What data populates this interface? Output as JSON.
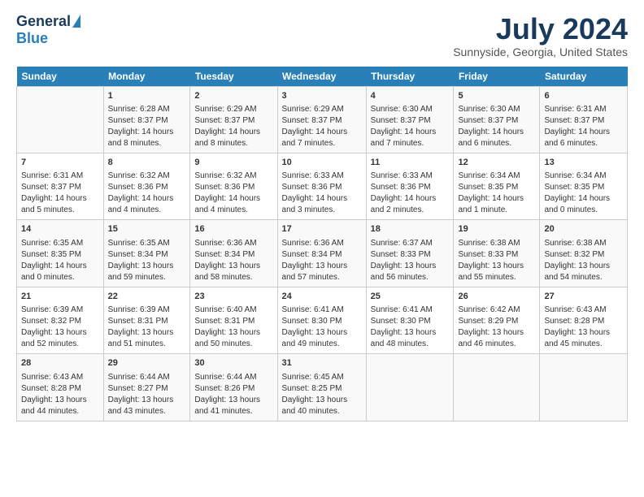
{
  "logo": {
    "general": "General",
    "blue": "Blue"
  },
  "title": "July 2024",
  "location": "Sunnyside, Georgia, United States",
  "days_header": [
    "Sunday",
    "Monday",
    "Tuesday",
    "Wednesday",
    "Thursday",
    "Friday",
    "Saturday"
  ],
  "weeks": [
    [
      {
        "day": "",
        "content": ""
      },
      {
        "day": "1",
        "content": "Sunrise: 6:28 AM\nSunset: 8:37 PM\nDaylight: 14 hours\nand 8 minutes."
      },
      {
        "day": "2",
        "content": "Sunrise: 6:29 AM\nSunset: 8:37 PM\nDaylight: 14 hours\nand 8 minutes."
      },
      {
        "day": "3",
        "content": "Sunrise: 6:29 AM\nSunset: 8:37 PM\nDaylight: 14 hours\nand 7 minutes."
      },
      {
        "day": "4",
        "content": "Sunrise: 6:30 AM\nSunset: 8:37 PM\nDaylight: 14 hours\nand 7 minutes."
      },
      {
        "day": "5",
        "content": "Sunrise: 6:30 AM\nSunset: 8:37 PM\nDaylight: 14 hours\nand 6 minutes."
      },
      {
        "day": "6",
        "content": "Sunrise: 6:31 AM\nSunset: 8:37 PM\nDaylight: 14 hours\nand 6 minutes."
      }
    ],
    [
      {
        "day": "7",
        "content": "Sunrise: 6:31 AM\nSunset: 8:37 PM\nDaylight: 14 hours\nand 5 minutes."
      },
      {
        "day": "8",
        "content": "Sunrise: 6:32 AM\nSunset: 8:36 PM\nDaylight: 14 hours\nand 4 minutes."
      },
      {
        "day": "9",
        "content": "Sunrise: 6:32 AM\nSunset: 8:36 PM\nDaylight: 14 hours\nand 4 minutes."
      },
      {
        "day": "10",
        "content": "Sunrise: 6:33 AM\nSunset: 8:36 PM\nDaylight: 14 hours\nand 3 minutes."
      },
      {
        "day": "11",
        "content": "Sunrise: 6:33 AM\nSunset: 8:36 PM\nDaylight: 14 hours\nand 2 minutes."
      },
      {
        "day": "12",
        "content": "Sunrise: 6:34 AM\nSunset: 8:35 PM\nDaylight: 14 hours\nand 1 minute."
      },
      {
        "day": "13",
        "content": "Sunrise: 6:34 AM\nSunset: 8:35 PM\nDaylight: 14 hours\nand 0 minutes."
      }
    ],
    [
      {
        "day": "14",
        "content": "Sunrise: 6:35 AM\nSunset: 8:35 PM\nDaylight: 14 hours\nand 0 minutes."
      },
      {
        "day": "15",
        "content": "Sunrise: 6:35 AM\nSunset: 8:34 PM\nDaylight: 13 hours\nand 59 minutes."
      },
      {
        "day": "16",
        "content": "Sunrise: 6:36 AM\nSunset: 8:34 PM\nDaylight: 13 hours\nand 58 minutes."
      },
      {
        "day": "17",
        "content": "Sunrise: 6:36 AM\nSunset: 8:34 PM\nDaylight: 13 hours\nand 57 minutes."
      },
      {
        "day": "18",
        "content": "Sunrise: 6:37 AM\nSunset: 8:33 PM\nDaylight: 13 hours\nand 56 minutes."
      },
      {
        "day": "19",
        "content": "Sunrise: 6:38 AM\nSunset: 8:33 PM\nDaylight: 13 hours\nand 55 minutes."
      },
      {
        "day": "20",
        "content": "Sunrise: 6:38 AM\nSunset: 8:32 PM\nDaylight: 13 hours\nand 54 minutes."
      }
    ],
    [
      {
        "day": "21",
        "content": "Sunrise: 6:39 AM\nSunset: 8:32 PM\nDaylight: 13 hours\nand 52 minutes."
      },
      {
        "day": "22",
        "content": "Sunrise: 6:39 AM\nSunset: 8:31 PM\nDaylight: 13 hours\nand 51 minutes."
      },
      {
        "day": "23",
        "content": "Sunrise: 6:40 AM\nSunset: 8:31 PM\nDaylight: 13 hours\nand 50 minutes."
      },
      {
        "day": "24",
        "content": "Sunrise: 6:41 AM\nSunset: 8:30 PM\nDaylight: 13 hours\nand 49 minutes."
      },
      {
        "day": "25",
        "content": "Sunrise: 6:41 AM\nSunset: 8:30 PM\nDaylight: 13 hours\nand 48 minutes."
      },
      {
        "day": "26",
        "content": "Sunrise: 6:42 AM\nSunset: 8:29 PM\nDaylight: 13 hours\nand 46 minutes."
      },
      {
        "day": "27",
        "content": "Sunrise: 6:43 AM\nSunset: 8:28 PM\nDaylight: 13 hours\nand 45 minutes."
      }
    ],
    [
      {
        "day": "28",
        "content": "Sunrise: 6:43 AM\nSunset: 8:28 PM\nDaylight: 13 hours\nand 44 minutes."
      },
      {
        "day": "29",
        "content": "Sunrise: 6:44 AM\nSunset: 8:27 PM\nDaylight: 13 hours\nand 43 minutes."
      },
      {
        "day": "30",
        "content": "Sunrise: 6:44 AM\nSunset: 8:26 PM\nDaylight: 13 hours\nand 41 minutes."
      },
      {
        "day": "31",
        "content": "Sunrise: 6:45 AM\nSunset: 8:25 PM\nDaylight: 13 hours\nand 40 minutes."
      },
      {
        "day": "",
        "content": ""
      },
      {
        "day": "",
        "content": ""
      },
      {
        "day": "",
        "content": ""
      }
    ]
  ]
}
